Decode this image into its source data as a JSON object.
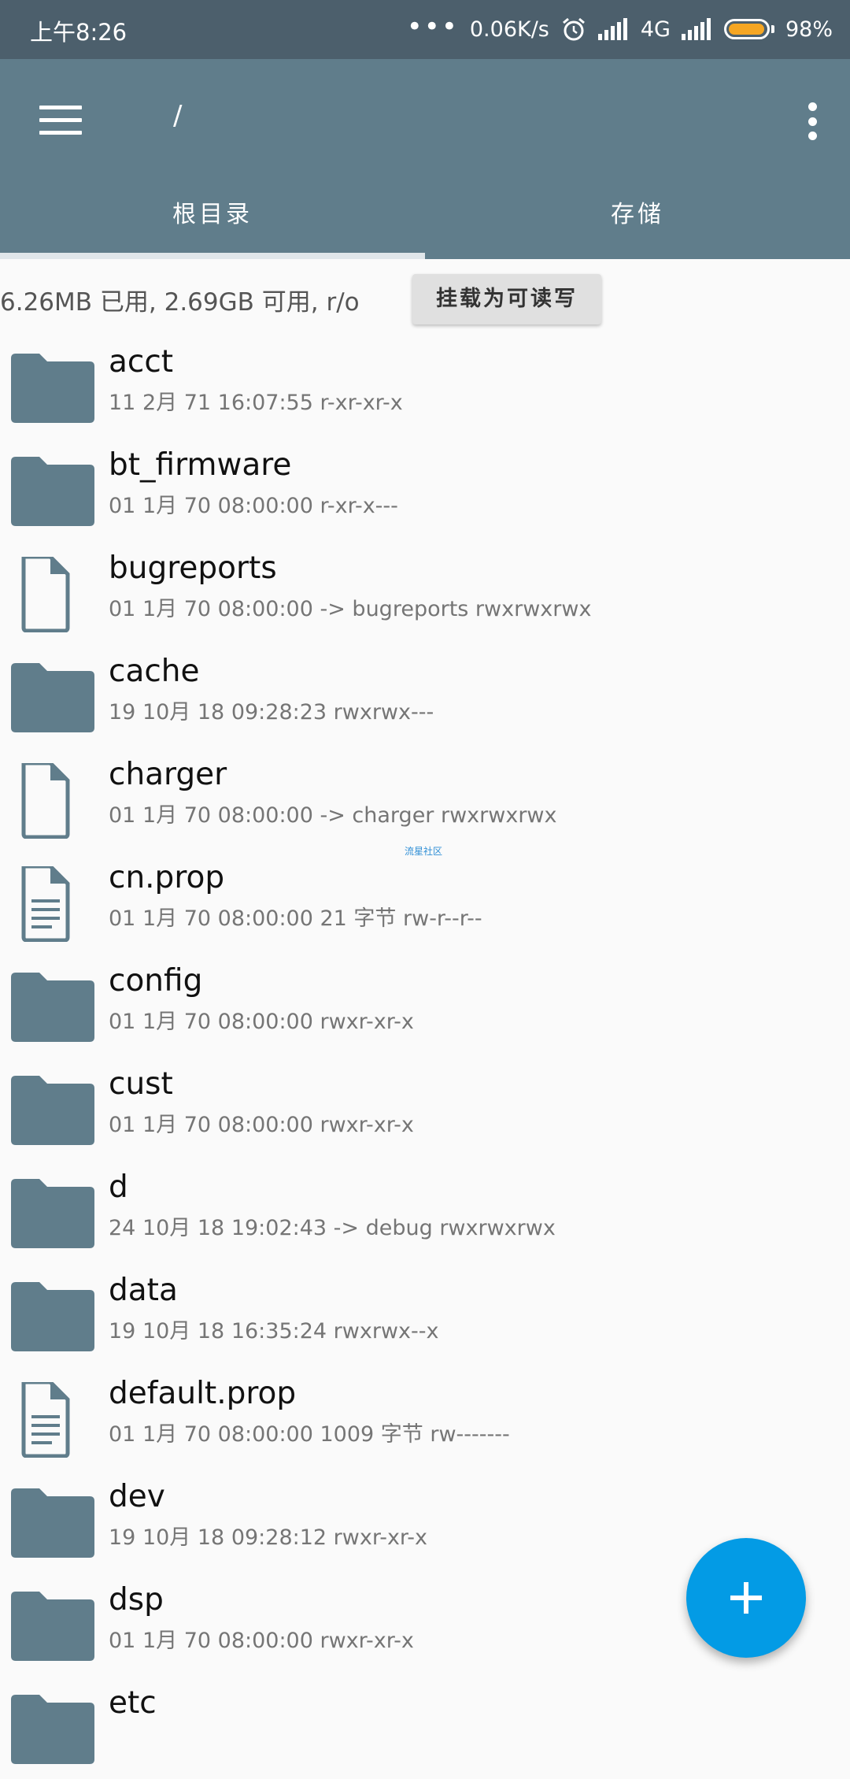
{
  "status_bar": {
    "time": "上午8:26",
    "dots": "•••",
    "net_speed": "0.06K/s",
    "network": "4G",
    "battery_percent": "98%",
    "battery_level": 0.98
  },
  "app_bar": {
    "path": "/",
    "tabs": [
      {
        "label": "根目录",
        "active": true
      },
      {
        "label": "存储",
        "active": false
      }
    ]
  },
  "storage": {
    "info": "6.26MB 已用, 2.69GB 可用, r/o",
    "mount_button": "挂载为可读写"
  },
  "watermark": "流星社区",
  "files": [
    {
      "name": "acct",
      "meta": "11 2月  71 16:07:55    r-xr-xr-x",
      "type": "folder"
    },
    {
      "name": "bt_firmware",
      "meta": "01 1月  70 08:00:00    r-xr-x---",
      "type": "folder"
    },
    {
      "name": "bugreports",
      "meta": "01 1月  70 08:00:00  -> bugreports  rwxrwxrwx",
      "type": "link"
    },
    {
      "name": "cache",
      "meta": "19 10月  18 09:28:23    rwxrwx---",
      "type": "folder"
    },
    {
      "name": "charger",
      "meta": "01 1月  70 08:00:00  -> charger  rwxrwxrwx",
      "type": "link"
    },
    {
      "name": "cn.prop",
      "meta": "01 1月  70 08:00:00  21 字节  rw-r--r--",
      "type": "doc"
    },
    {
      "name": "config",
      "meta": "01 1月  70 08:00:00    rwxr-xr-x",
      "type": "folder"
    },
    {
      "name": "cust",
      "meta": "01 1月  70 08:00:00    rwxr-xr-x",
      "type": "folder"
    },
    {
      "name": "d",
      "meta": "24 10月  18 19:02:43  -> debug  rwxrwxrwx",
      "type": "folder"
    },
    {
      "name": "data",
      "meta": "19 10月  18 16:35:24    rwxrwx--x",
      "type": "folder"
    },
    {
      "name": "default.prop",
      "meta": "01 1月  70 08:00:00  1009 字节  rw-------",
      "type": "doc"
    },
    {
      "name": "dev",
      "meta": "19 10月  18 09:28:12    rwxr-xr-x",
      "type": "folder"
    },
    {
      "name": "dsp",
      "meta": "01 1月  70 08:00:00    rwxr-xr-x",
      "type": "folder"
    },
    {
      "name": "etc",
      "meta": "",
      "type": "folder"
    }
  ],
  "icons": {
    "folder": "folder-icon",
    "link": "file-icon",
    "doc": "text-file-icon",
    "fab": "plus-icon"
  },
  "colors": {
    "status_bar": "#4c5f6c",
    "app_bar": "#607d8b",
    "folder_icon": "#607d8b",
    "fab": "#039be5",
    "battery": "#f5a623"
  }
}
